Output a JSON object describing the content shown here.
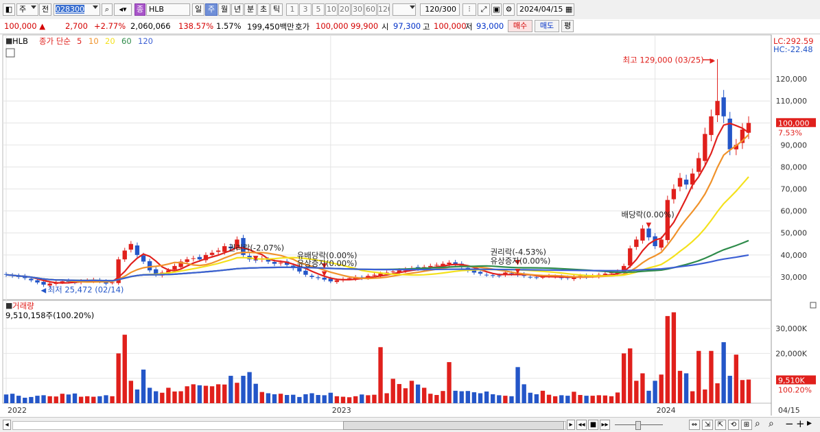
{
  "toolbar": {
    "period_type": "주",
    "prev_label": "전",
    "code": "028300",
    "market_badge": "종",
    "stock_name": "HLB",
    "tabs": [
      "일",
      "주",
      "월",
      "년",
      "분",
      "초",
      "틱"
    ],
    "active_tab": "주",
    "intervals": [
      "1",
      "3",
      "5",
      "10",
      "20",
      "30",
      "60",
      "120"
    ],
    "count_value": "120",
    "count_total": "/300",
    "date": "2024/04/15"
  },
  "quote": {
    "price": "100,000",
    "change": "2,700",
    "change_pct": "+2.77%",
    "volume": "2,060,066",
    "volume_ratio": "138.57%",
    "turnover": "1.57%",
    "amount": "199,450백만",
    "bid_label": "호가",
    "ask": "100,000",
    "bid": "99,900",
    "open_label": "시",
    "open": "97,300",
    "high_label": "고",
    "high": "100,000",
    "low_label": "저",
    "low": "93,000",
    "buy_label": "매수",
    "sell_label": "매도",
    "eval_label": "평"
  },
  "colors": {
    "up": "#e0201c",
    "down": "#2456c8",
    "ma5": "#e0201c",
    "ma10": "#f0922a",
    "ma20": "#f4e11c",
    "ma60": "#2e8b4a",
    "ma120": "#3c5fd4"
  },
  "chart_data": [
    {
      "type": "candlestick",
      "legend": {
        "name": "HLB",
        "label": "종가 단순",
        "periods": [
          "5",
          "10",
          "20",
          "60",
          "120"
        ]
      },
      "labels": {
        "lc": "LC:292.59",
        "hc": "HC:-22.48",
        "current": "100,000",
        "current_pct": "7.53%"
      },
      "ylim": [
        20000,
        135000
      ],
      "y_ticks": [
        30000,
        40000,
        50000,
        60000,
        70000,
        80000,
        90000,
        100000,
        110000,
        120000
      ],
      "y_tick_labels": [
        "30,000",
        "40,000",
        "50,000",
        "60,000",
        "70,000",
        "80,000",
        "90,000",
        "100,000",
        "110,000",
        "120,000"
      ],
      "x_labels": [
        {
          "label": "2022",
          "week": 0
        },
        {
          "label": "2023",
          "week": 52
        },
        {
          "label": "2024",
          "week": 104
        },
        {
          "label": "04/15",
          "week": 119
        }
      ],
      "annotations": [
        {
          "text": "최고 129,000 (03/25)",
          "week": 114,
          "value": 129000,
          "kind": "high"
        },
        {
          "text": "최저 25,472 (02/14)",
          "week": 6,
          "value": 25472,
          "kind": "low"
        },
        {
          "text": "권리락(-2.07%)",
          "week": 40,
          "value": 42000,
          "kind": "event"
        },
        {
          "text": "유배당락(0.00%)",
          "week": 51,
          "value": 35500,
          "kind": "event"
        },
        {
          "text": "유상증자(0.00%)",
          "week": 51,
          "value": 35000,
          "kind": "event"
        },
        {
          "text": "권리락(-4.53%)",
          "week": 82,
          "value": 37000,
          "kind": "event"
        },
        {
          "text": "유상증자(0.00%)",
          "week": 82,
          "value": 36000,
          "kind": "event"
        },
        {
          "text": "배당락(0.00%)",
          "week": 103,
          "value": 54000,
          "kind": "event"
        }
      ],
      "close": [
        31000,
        30500,
        30000,
        29500,
        28500,
        27500,
        26500,
        27000,
        27500,
        28000,
        27800,
        27500,
        28200,
        28500,
        28800,
        28000,
        27000,
        27500,
        38000,
        42000,
        45000,
        40000,
        37000,
        33000,
        31000,
        32000,
        33000,
        35000,
        37000,
        38000,
        38500,
        38000,
        40000,
        41000,
        42000,
        44000,
        43000,
        47000,
        40000,
        38000,
        37500,
        38500,
        37000,
        36000,
        36500,
        35500,
        34000,
        32500,
        31000,
        30000,
        29500,
        28800,
        28000,
        28500,
        29000,
        29500,
        30000,
        29500,
        30500,
        31000,
        31500,
        32000,
        32500,
        33000,
        33500,
        34000,
        33800,
        34500,
        35000,
        35500,
        36000,
        36500,
        35500,
        34500,
        33000,
        32000,
        31500,
        31000,
        30500,
        30500,
        32000,
        31500,
        31000,
        30500,
        30000,
        29800,
        30000,
        30500,
        30200,
        29500,
        29500,
        30000,
        30500,
        30000,
        30500,
        31000,
        31500,
        32000,
        32500,
        35000,
        43000,
        47000,
        52000,
        48000,
        44000,
        47000,
        65000,
        70000,
        75000,
        72000,
        77000,
        84000,
        95000,
        103000,
        110000,
        103000,
        88000,
        90000,
        97000,
        100000
      ],
      "volume_k": [
        3500,
        3800,
        3000,
        2200,
        2500,
        3000,
        3200,
        2800,
        2700,
        3800,
        3500,
        3900,
        2600,
        2800,
        2600,
        2800,
        3200,
        2800,
        20000,
        27500,
        9000,
        5500,
        13500,
        6200,
        4800,
        4200,
        6200,
        4700,
        4800,
        6800,
        7600,
        7200,
        7000,
        6800,
        7600,
        7500,
        11000,
        8200,
        11000,
        12500,
        7800,
        4500,
        4000,
        3600,
        3800,
        3300,
        3400,
        2500,
        3600,
        4000,
        3300,
        3200,
        4200,
        2800,
        2600,
        2400,
        2800,
        3500,
        3200,
        3400,
        22500,
        4000,
        9800,
        7700,
        6000,
        9000,
        7500,
        6200,
        3800,
        3300,
        4900,
        16500,
        5000,
        4800,
        4900,
        4400,
        4000,
        4700,
        3600,
        3200,
        3000,
        2800,
        14500,
        7600,
        4200,
        3600,
        5000,
        3400,
        2800,
        3200,
        3000,
        4600,
        3300,
        3000,
        3000,
        3200,
        3100,
        2800,
        4300,
        20000,
        22000,
        9000,
        12000,
        5000,
        9000,
        11500,
        35000,
        36500,
        13000,
        12000,
        4800,
        21000,
        5500,
        21000,
        8000,
        24500,
        11000,
        19500,
        9300,
        9500
      ],
      "volume_ylim": [
        0,
        38000
      ],
      "volume_ticks": [
        10000,
        20000,
        30000
      ],
      "volume_tick_labels": [
        "10,000K",
        "20,000K",
        "30,000K"
      ],
      "volume_title": "거래량",
      "volume_info": "9,510,158주(100.20%)",
      "volume_current_label": "9,510K",
      "volume_current_pct": "100.20%"
    }
  ]
}
